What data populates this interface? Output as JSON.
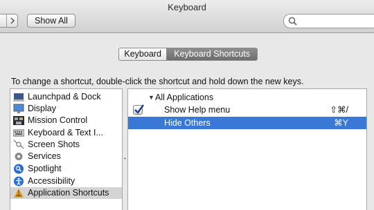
{
  "window": {
    "title": "Keyboard"
  },
  "toolbar": {
    "show_all_label": "Show All",
    "search_placeholder": ""
  },
  "tabs": [
    {
      "label": "Keyboard",
      "selected": false
    },
    {
      "label": "Keyboard Shortcuts",
      "selected": true
    }
  ],
  "instruction": "To change a shortcut, double-click the shortcut and hold down the new keys.",
  "categories": [
    {
      "label": "Launchpad & Dock",
      "icon": "launchpad-dock-icon"
    },
    {
      "label": "Display",
      "icon": "display-icon"
    },
    {
      "label": "Mission Control",
      "icon": "mission-control-icon"
    },
    {
      "label": "Keyboard & Text I...",
      "icon": "keyboard-icon"
    },
    {
      "label": "Screen Shots",
      "icon": "screenshot-icon"
    },
    {
      "label": "Services",
      "icon": "services-gear-icon"
    },
    {
      "label": "Spotlight",
      "icon": "spotlight-icon"
    },
    {
      "label": "Accessibility",
      "icon": "accessibility-icon"
    },
    {
      "label": "Application Shortcuts",
      "icon": "application-shortcuts-icon",
      "selected": true
    }
  ],
  "shortcuts": {
    "group": "All Applications",
    "items": [
      {
        "label": "Show Help menu",
        "keys": "⇧⌘/",
        "checked": true,
        "selected": false
      },
      {
        "label": "Hide Others",
        "keys": "⌘Y",
        "checked": false,
        "selected": true
      }
    ]
  },
  "colors": {
    "selection": "#3a78d8",
    "selected_tab": "#7a7a7a"
  }
}
